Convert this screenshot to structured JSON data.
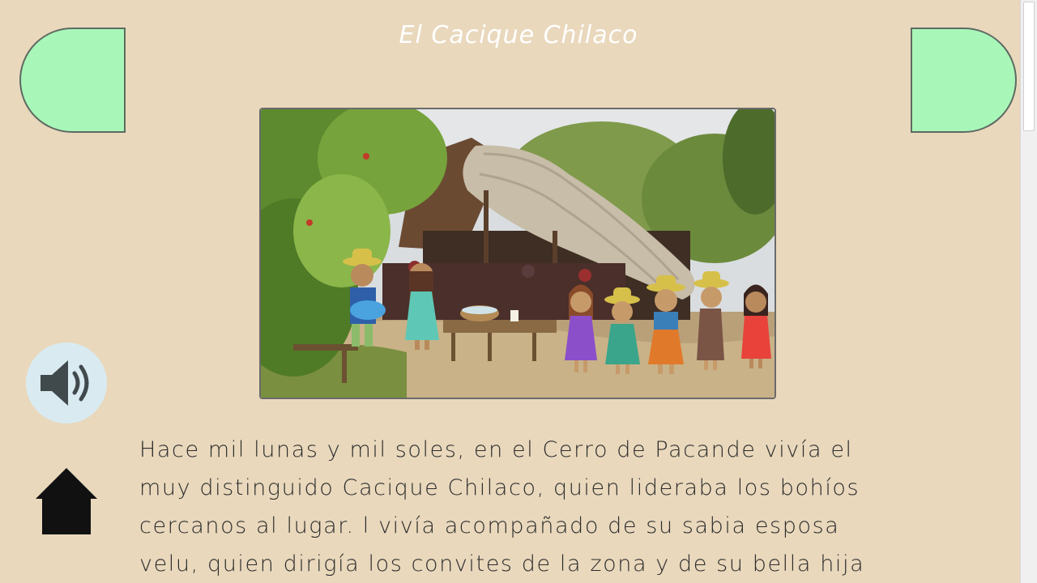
{
  "story": {
    "title": "El Cacique Chilaco",
    "lines": [
      "Hace mil lunas y mil soles, en el Cerro de Pacande vivía el",
      "muy distinguido Cacique Chilaco, quien lideraba los bohíos",
      "cercanos al lugar. l vivía acompañado de su sabia esposa",
      "velu, quien dirigía los convites de la zona y de su bella hija"
    ]
  },
  "navigation": {
    "previous_icon": "half-circle-left",
    "next_icon": "half-circle-right",
    "button_color": "#a8f7b9"
  },
  "controls": {
    "audio_icon": "speaker-icon",
    "home_icon": "house-icon"
  },
  "colors": {
    "background": "#e9d8bc",
    "title": "#ffffff",
    "text": "#2c2c2c",
    "audio_bg": "#d9ebf1"
  }
}
